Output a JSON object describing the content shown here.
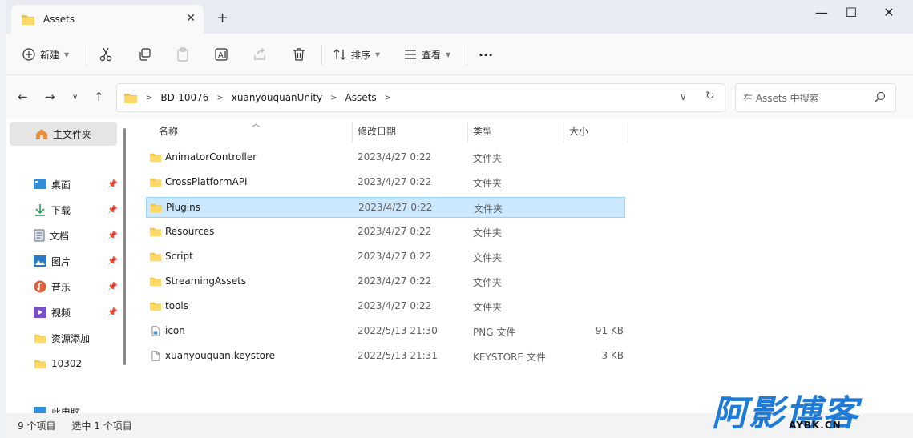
{
  "titlebar": {
    "tab_title": "Assets",
    "new_tab": "+",
    "close_tab": "✕",
    "minimize": "—",
    "maximize": "☐",
    "close": "✕"
  },
  "toolbar": {
    "new_label": "新建",
    "sort_label": "排序",
    "view_label": "查看",
    "more_label": "···"
  },
  "address": {
    "crumbs": [
      "BD-10076",
      "xuanyouquanUnity",
      "Assets"
    ],
    "search_placeholder": "在 Assets 中搜索"
  },
  "sidebar": {
    "home": "主文件夹",
    "items": [
      {
        "label": "桌面",
        "icon": "desktop-icon",
        "color": "#2f8fd8",
        "pinned": true
      },
      {
        "label": "下载",
        "icon": "download-icon",
        "color": "#2c9a5b",
        "pinned": true
      },
      {
        "label": "文档",
        "icon": "documents-icon",
        "color": "#5a6b7b",
        "pinned": true
      },
      {
        "label": "图片",
        "icon": "pictures-icon",
        "color": "#2b78c4",
        "pinned": true
      },
      {
        "label": "音乐",
        "icon": "music-icon",
        "color": "#e0603c",
        "pinned": true
      },
      {
        "label": "视频",
        "icon": "videos-icon",
        "color": "#7b4fc9",
        "pinned": true
      },
      {
        "label": "资源添加",
        "icon": "folder-icon",
        "color": "#f4c542",
        "pinned": false
      },
      {
        "label": "10302",
        "icon": "folder-icon",
        "color": "#f4c542",
        "pinned": false
      }
    ],
    "partial": "此电脑"
  },
  "columns": {
    "name": "名称",
    "date": "修改日期",
    "type": "类型",
    "size": "大小"
  },
  "files": [
    {
      "name": "AnimatorController",
      "date": "2023/4/27 0:22",
      "type": "文件夹",
      "size": "",
      "kind": "folder"
    },
    {
      "name": "CrossPlatformAPI",
      "date": "2023/4/27 0:22",
      "type": "文件夹",
      "size": "",
      "kind": "folder"
    },
    {
      "name": "Plugins",
      "date": "2023/4/27 0:22",
      "type": "文件夹",
      "size": "",
      "kind": "folder",
      "selected": true
    },
    {
      "name": "Resources",
      "date": "2023/4/27 0:22",
      "type": "文件夹",
      "size": "",
      "kind": "folder"
    },
    {
      "name": "Script",
      "date": "2023/4/27 0:22",
      "type": "文件夹",
      "size": "",
      "kind": "folder"
    },
    {
      "name": "StreamingAssets",
      "date": "2023/4/27 0:22",
      "type": "文件夹",
      "size": "",
      "kind": "folder"
    },
    {
      "name": "tools",
      "date": "2023/4/27 0:22",
      "type": "文件夹",
      "size": "",
      "kind": "folder"
    },
    {
      "name": "icon",
      "date": "2022/5/13 21:30",
      "type": "PNG 文件",
      "size": "91 KB",
      "kind": "image"
    },
    {
      "name": "xuanyouquan.keystore",
      "date": "2022/5/13 21:31",
      "type": "KEYSTORE 文件",
      "size": "3 KB",
      "kind": "file"
    }
  ],
  "status": {
    "count": "9 个项目",
    "selected": "选中 1 个项目"
  },
  "watermark": {
    "main": "阿影博客",
    "sub": "AYBK.CN"
  },
  "colors": {
    "selection": "#cce8ff",
    "folder": "#f4c542",
    "watermark": "#1e7cd8"
  }
}
